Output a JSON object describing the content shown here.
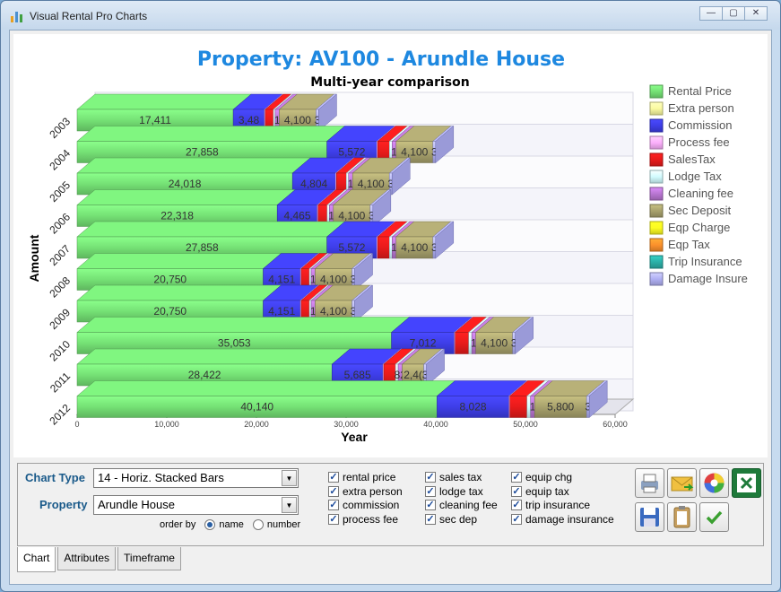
{
  "window": {
    "title": "Visual Rental Pro Charts",
    "min": "—",
    "max": "▢",
    "close": "✕"
  },
  "chart": {
    "title": "Property:  AV100 - Arundle House",
    "subtitle": "Multi-year comparison"
  },
  "chart_data": {
    "type": "bar",
    "orientation": "horizontal-stacked",
    "title": "Property:  AV100 - Arundle House",
    "subtitle": "Multi-year comparison",
    "xlabel": "Year",
    "ylabel": "Amount",
    "xlim": [
      0,
      60000
    ],
    "xticks": [
      "0",
      "10,000",
      "20,000",
      "30,000",
      "40,000",
      "50,000",
      "60,000"
    ],
    "categories": [
      "2003",
      "2004",
      "2005",
      "2006",
      "2007",
      "2008",
      "2009",
      "2010",
      "2011",
      "2012"
    ],
    "series": [
      {
        "name": "Rental Price",
        "color": "#6fd66f",
        "values": [
          17411,
          27858,
          24018,
          22318,
          27858,
          20750,
          20750,
          35053,
          28422,
          40140
        ],
        "labels": [
          "17,411",
          "27,858",
          "24,018",
          "22,318",
          "27,858",
          "20,750",
          "20,750",
          "35,053",
          "28,422",
          "40,140"
        ]
      },
      {
        "name": "Extra person",
        "color": "#eeee99",
        "values": [
          0,
          0,
          0,
          0,
          0,
          0,
          0,
          0,
          0,
          0
        ],
        "labels": [
          "",
          "",
          "",
          "",
          "",
          "",
          "",
          "",
          "",
          ""
        ]
      },
      {
        "name": "Commission",
        "color": "#3b3bdd",
        "values": [
          3482,
          5572,
          4804,
          4465,
          5572,
          4151,
          4151,
          7012,
          5685,
          8028
        ],
        "labels": [
          "3,48",
          "5,572",
          "4,804",
          "4,465",
          "5,572",
          "4,151",
          "4,151",
          "7,012",
          "5,685",
          "8,028"
        ]
      },
      {
        "name": "Process fee",
        "color": "#f0a8f0",
        "values": [
          100,
          100,
          100,
          100,
          100,
          100,
          100,
          100,
          100,
          100
        ],
        "labels": [
          "",
          "",
          "",
          "",
          "",
          "",
          "",
          "",
          "",
          ""
        ]
      },
      {
        "name": "SalesTax",
        "color": "#dd1a1a",
        "values": [
          900,
          1300,
          1100,
          1000,
          1300,
          900,
          900,
          1500,
          1300,
          1900
        ],
        "labels": [
          "",
          "",
          "",
          "",
          "",
          "",
          "",
          "",
          "",
          ""
        ]
      },
      {
        "name": "Lodge Tax",
        "color": "#c8f0f4",
        "values": [
          200,
          300,
          250,
          250,
          300,
          200,
          200,
          350,
          300,
          400
        ],
        "labels": [
          "",
          "",
          "",
          "",
          "",
          "",
          "",
          "",
          "",
          ""
        ]
      },
      {
        "name": "Cleaning fee",
        "color": "#b070c8",
        "values": [
          450,
          450,
          450,
          450,
          450,
          450,
          450,
          450,
          450,
          450
        ],
        "labels": [
          "1",
          "1",
          "1",
          "1",
          "1",
          "1",
          "1",
          "1",
          "82",
          "1"
        ]
      },
      {
        "name": "Sec Deposit",
        "color": "#a09a68",
        "values": [
          4100,
          4100,
          4100,
          4100,
          4100,
          4100,
          4100,
          4100,
          2400,
          5800
        ],
        "labels": [
          "4,100",
          "4,100",
          "4,100",
          "4,100",
          "4,100",
          "4,100",
          "4,100",
          "4,100",
          "2,4(",
          "5,800"
        ]
      },
      {
        "name": "Eqp Charge",
        "color": "#f0f020",
        "values": [
          0,
          0,
          0,
          0,
          0,
          0,
          0,
          0,
          0,
          0
        ],
        "labels": [
          "",
          "",
          "",
          "",
          "",
          "",
          "",
          "",
          "",
          ""
        ]
      },
      {
        "name": "Eqp Tax",
        "color": "#f08a2a",
        "values": [
          0,
          0,
          0,
          0,
          0,
          0,
          0,
          0,
          0,
          0
        ],
        "labels": [
          "",
          "",
          "",
          "",
          "",
          "",
          "",
          "",
          "",
          ""
        ]
      },
      {
        "name": "Trip Insurance",
        "color": "#2aa8a0",
        "values": [
          0,
          0,
          0,
          0,
          0,
          0,
          0,
          0,
          0,
          0
        ],
        "labels": [
          "",
          "",
          "",
          "",
          "",
          "",
          "",
          "",
          "",
          ""
        ]
      },
      {
        "name": "Damage Insure",
        "color": "#a8a8e8",
        "values": [
          300,
          300,
          300,
          300,
          300,
          300,
          300,
          300,
          300,
          300
        ],
        "labels": [
          "3",
          "3",
          "3",
          "3",
          "3",
          "3",
          "3",
          "3",
          "3",
          "3"
        ]
      }
    ],
    "legend": "right",
    "grid": true
  },
  "controls": {
    "chart_type_label": "Chart Type",
    "chart_type_value": "14 - Horiz. Stacked Bars",
    "property_label": "Property",
    "property_value": "Arundle House",
    "order_by": "order by",
    "order_name": "name",
    "order_number": "number"
  },
  "checks": [
    {
      "label": "rental price"
    },
    {
      "label": "extra person"
    },
    {
      "label": "commission"
    },
    {
      "label": "process fee"
    },
    {
      "label": "sales tax"
    },
    {
      "label": "lodge tax"
    },
    {
      "label": "cleaning fee"
    },
    {
      "label": "sec dep"
    },
    {
      "label": "equip chg"
    },
    {
      "label": "equip tax"
    },
    {
      "label": "trip insurance"
    },
    {
      "label": "damage insurance"
    }
  ],
  "tabs": [
    {
      "label": "Chart"
    },
    {
      "label": "Attributes"
    },
    {
      "label": "Timeframe"
    }
  ]
}
